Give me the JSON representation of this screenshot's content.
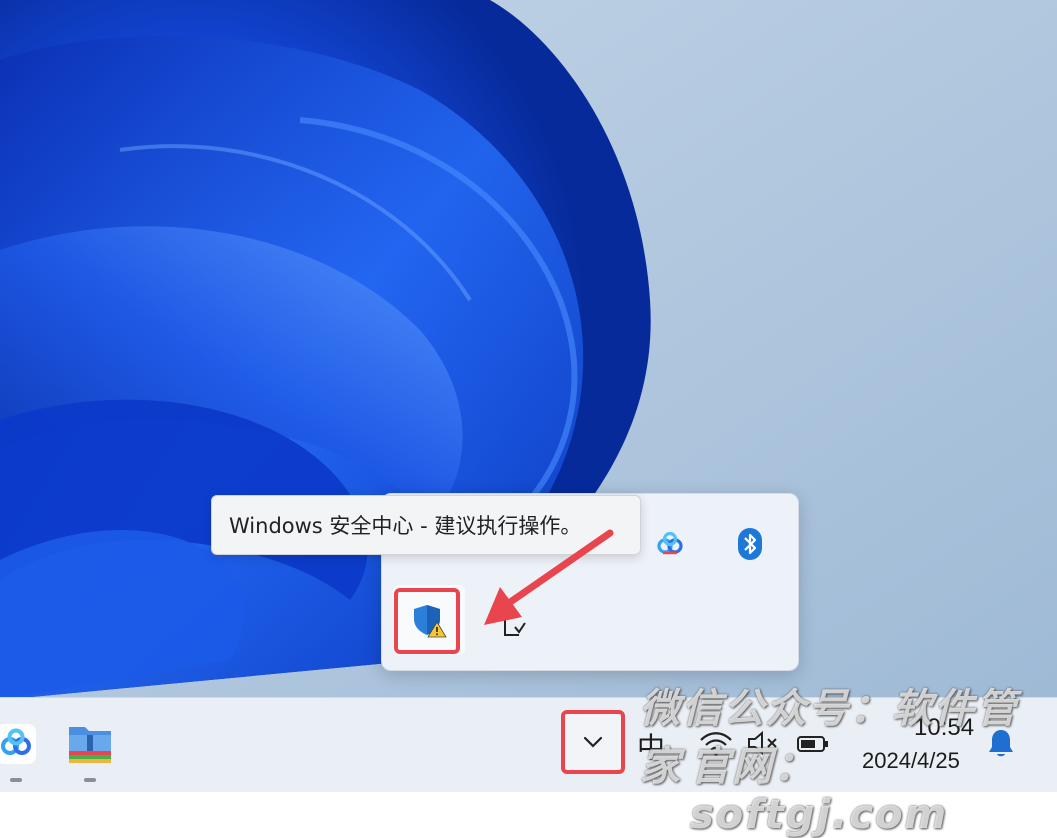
{
  "tooltip": {
    "text": "Windows 安全中心 - 建议执行操作。"
  },
  "tray": {
    "icons": [
      {
        "name": "baidu-netdisk-icon"
      },
      {
        "name": "bluetooth-icon"
      },
      {
        "name": "windows-security-warning-icon"
      },
      {
        "name": "safely-remove-hardware-icon"
      }
    ]
  },
  "taskbar": {
    "apps": [
      {
        "name": "baidu-netdisk-app-icon"
      },
      {
        "name": "winrar-archive-app-icon"
      }
    ],
    "ime_label": "中",
    "clock": {
      "time": "10:54",
      "date": "2024/4/25"
    }
  },
  "watermark": {
    "line1": "微信公众号：软件管家",
    "line2": "官网：softgj.com"
  },
  "colors": {
    "highlight": "#e8454f",
    "taskbar": "#eaeef5",
    "wallpaper_bg": "#a9c3dd",
    "accent_blue": "#1e78d8"
  }
}
